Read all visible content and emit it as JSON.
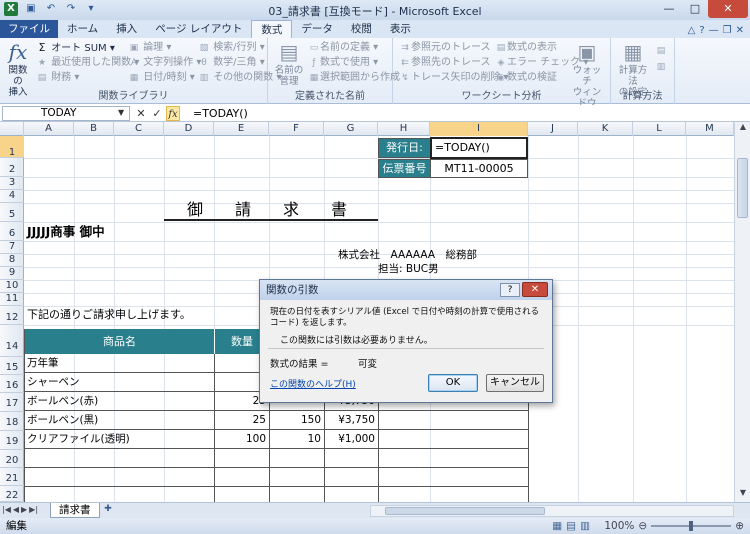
{
  "window": {
    "title": "03_請求書 [互換モード] - Microsoft Excel",
    "qat_icons": [
      "excel-app-icon",
      "save-icon",
      "undo-icon",
      "redo-icon",
      "customize-qat-icon"
    ],
    "controls": {
      "minimize": "—",
      "maximize": "□",
      "close": "✕"
    }
  },
  "ribbon": {
    "tabs": [
      "ファイル",
      "ホーム",
      "挿入",
      "ページ レイアウト",
      "数式",
      "データ",
      "校閲",
      "表示"
    ],
    "active_tab": "数式",
    "groups": {
      "function_library": {
        "label": "関数ライブラリ",
        "insert_function": "関数の\n挿入",
        "autosum": "オート SUM",
        "recent": "最近使用した関数",
        "financial": "財務",
        "logical": "論理",
        "text": "文字列操作",
        "datetime": "日付/時刻",
        "lookup": "検索/行列",
        "math": "数学/三角",
        "more": "その他の関数"
      },
      "defined_names": {
        "label": "定義された名前",
        "name_manager": "名前の\n管理",
        "define_name": "名前の定義",
        "use_in_formula": "数式で使用",
        "create_from_selection": "選択範囲から作成"
      },
      "formula_auditing": {
        "label": "ワークシート分析",
        "trace_precedents": "参照元のトレース",
        "trace_dependents": "参照先のトレース",
        "remove_arrows": "トレース矢印の削除",
        "show_formulas": "数式の表示",
        "error_checking": "エラー チェック",
        "evaluate_formula": "数式の検証",
        "watch_window": "ウォッチ\nウィンドウ"
      },
      "calculation": {
        "label": "計算方法",
        "calc_options": "計算方法\nの設定"
      }
    }
  },
  "formula_bar": {
    "name_box": "TODAY",
    "formula": "=TODAY()"
  },
  "grid": {
    "columns": [
      "A",
      "B",
      "C",
      "D",
      "E",
      "F",
      "G",
      "H",
      "I",
      "J",
      "K",
      "L",
      "M"
    ],
    "rows": [
      "1",
      "2",
      "3",
      "4",
      "5",
      "6",
      "7",
      "8",
      "9",
      "10",
      "11",
      "12",
      "14",
      "15",
      "16",
      "17",
      "18",
      "19",
      "20",
      "21",
      "22"
    ],
    "selected_column": "I",
    "selected_row": "1"
  },
  "sheet": {
    "issue_date_label": "発行日:",
    "issue_date_value": "=TODAY()",
    "slip_number_label": "伝票番号",
    "slip_number_value": "MT11-00005",
    "title": "御　請　求　書",
    "customer": "JJJJJ商事 御中",
    "company": "株式会社　AAAAAA　総務部",
    "person": "担当: BUC男",
    "intro": "下記の通りご請求申し上げます。",
    "table": {
      "headers": [
        "商品名",
        "数量"
      ],
      "rows": [
        {
          "name": "万年筆",
          "qty": "",
          "price": "",
          "amount": ""
        },
        {
          "name": "シャーペン",
          "qty": "1",
          "price": "",
          "amount": ""
        },
        {
          "name": "ボールペン(赤)",
          "qty": "25",
          "price": "",
          "amount": "¥3,750"
        },
        {
          "name": "ボールペン(黒)",
          "qty": "25",
          "price": "150",
          "amount": "¥3,750"
        },
        {
          "name": "クリアファイル(透明)",
          "qty": "100",
          "price": "10",
          "amount": "¥1,000"
        },
        {
          "name": "",
          "qty": "",
          "price": "",
          "amount": ""
        },
        {
          "name": "",
          "qty": "",
          "price": "",
          "amount": ""
        },
        {
          "name": "",
          "qty": "",
          "price": "",
          "amount": ""
        }
      ]
    }
  },
  "sheet_tabs": {
    "active": "請求書"
  },
  "status": {
    "mode": "編集",
    "zoom": "100%"
  },
  "dialog": {
    "title": "関数の引数",
    "help_btn": "?",
    "close_btn": "✕",
    "description": "現在の日付を表すシリアル値 (Excel で日付や時刻の計算で使用されるコード) を返します。",
    "no_args": "この関数には引数は必要ありません。",
    "result_label": "数式の結果 =",
    "result_value": "可変",
    "help_link": "この関数のヘルプ(H)",
    "ok": "OK",
    "cancel": "キャンセル"
  }
}
